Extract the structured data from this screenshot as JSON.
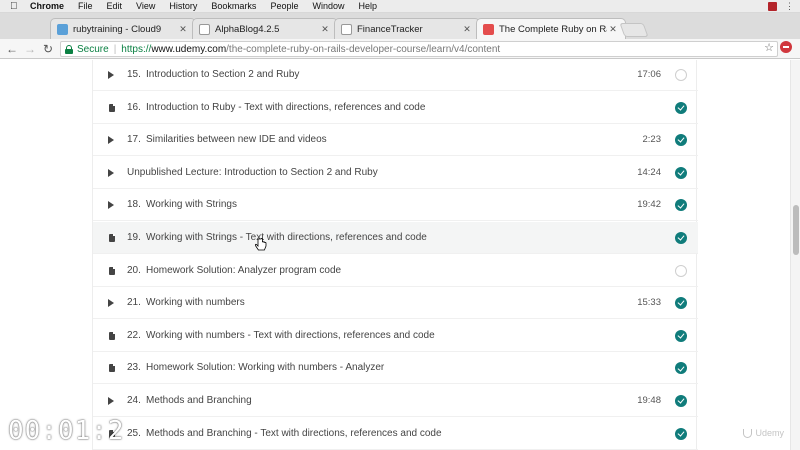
{
  "menubar": {
    "app": "Chrome",
    "items": [
      "File",
      "Edit",
      "View",
      "History",
      "Bookmarks",
      "People",
      "Window",
      "Help"
    ]
  },
  "tabs": [
    {
      "label": "rubytraining - Cloud9",
      "icon_color": "#5aa0d8"
    },
    {
      "label": "AlphaBlog4.2.5",
      "icon_color": "#ffffff"
    },
    {
      "label": "FinanceTracker",
      "icon_color": "#ffffff"
    },
    {
      "label": "The Complete Ruby on Rails D",
      "icon_color": "#e44d4d"
    }
  ],
  "address": {
    "secure_label": "Secure",
    "scheme": "https://",
    "host": "www.udemy.com",
    "path": "/the-complete-ruby-on-rails-developer-course/learn/v4/content"
  },
  "lectures": [
    {
      "num": "15.",
      "title": "Introduction to Section 2 and Ruby",
      "time": "17:06",
      "type": "video",
      "done": false
    },
    {
      "num": "16.",
      "title": "Introduction to Ruby - Text with directions, references and code",
      "time": "",
      "type": "doc",
      "done": true
    },
    {
      "num": "17.",
      "title": "Similarities between new IDE and videos",
      "time": "2:23",
      "type": "video",
      "done": true
    },
    {
      "num": "",
      "title": "Unpublished Lecture: Introduction to Section 2 and Ruby",
      "time": "14:24",
      "type": "video",
      "done": true
    },
    {
      "num": "18.",
      "title": "Working with Strings",
      "time": "19:42",
      "type": "video",
      "done": true
    },
    {
      "num": "19.",
      "title": "Working with Strings - Text with directions, references and code",
      "time": "",
      "type": "doc",
      "done": true
    },
    {
      "num": "20.",
      "title": "Homework Solution: Analyzer program code",
      "time": "",
      "type": "doc",
      "done": false
    },
    {
      "num": "21.",
      "title": "Working with numbers",
      "time": "15:33",
      "type": "video",
      "done": true
    },
    {
      "num": "22.",
      "title": "Working with numbers - Text with directions, references and code",
      "time": "",
      "type": "doc",
      "done": true
    },
    {
      "num": "23.",
      "title": "Homework Solution: Working with numbers - Analyzer",
      "time": "",
      "type": "doc",
      "done": true
    },
    {
      "num": "24.",
      "title": "Methods and Branching",
      "time": "19:48",
      "type": "video",
      "done": true
    },
    {
      "num": "25.",
      "title": "Methods and Branching - Text with directions, references and code",
      "time": "",
      "type": "doc",
      "done": true
    }
  ],
  "overlay": {
    "timecode": "00:01:2",
    "watermark": "Udemy"
  },
  "colors": {
    "check_done": "#107c7b",
    "secure_green": "#0b8043"
  }
}
